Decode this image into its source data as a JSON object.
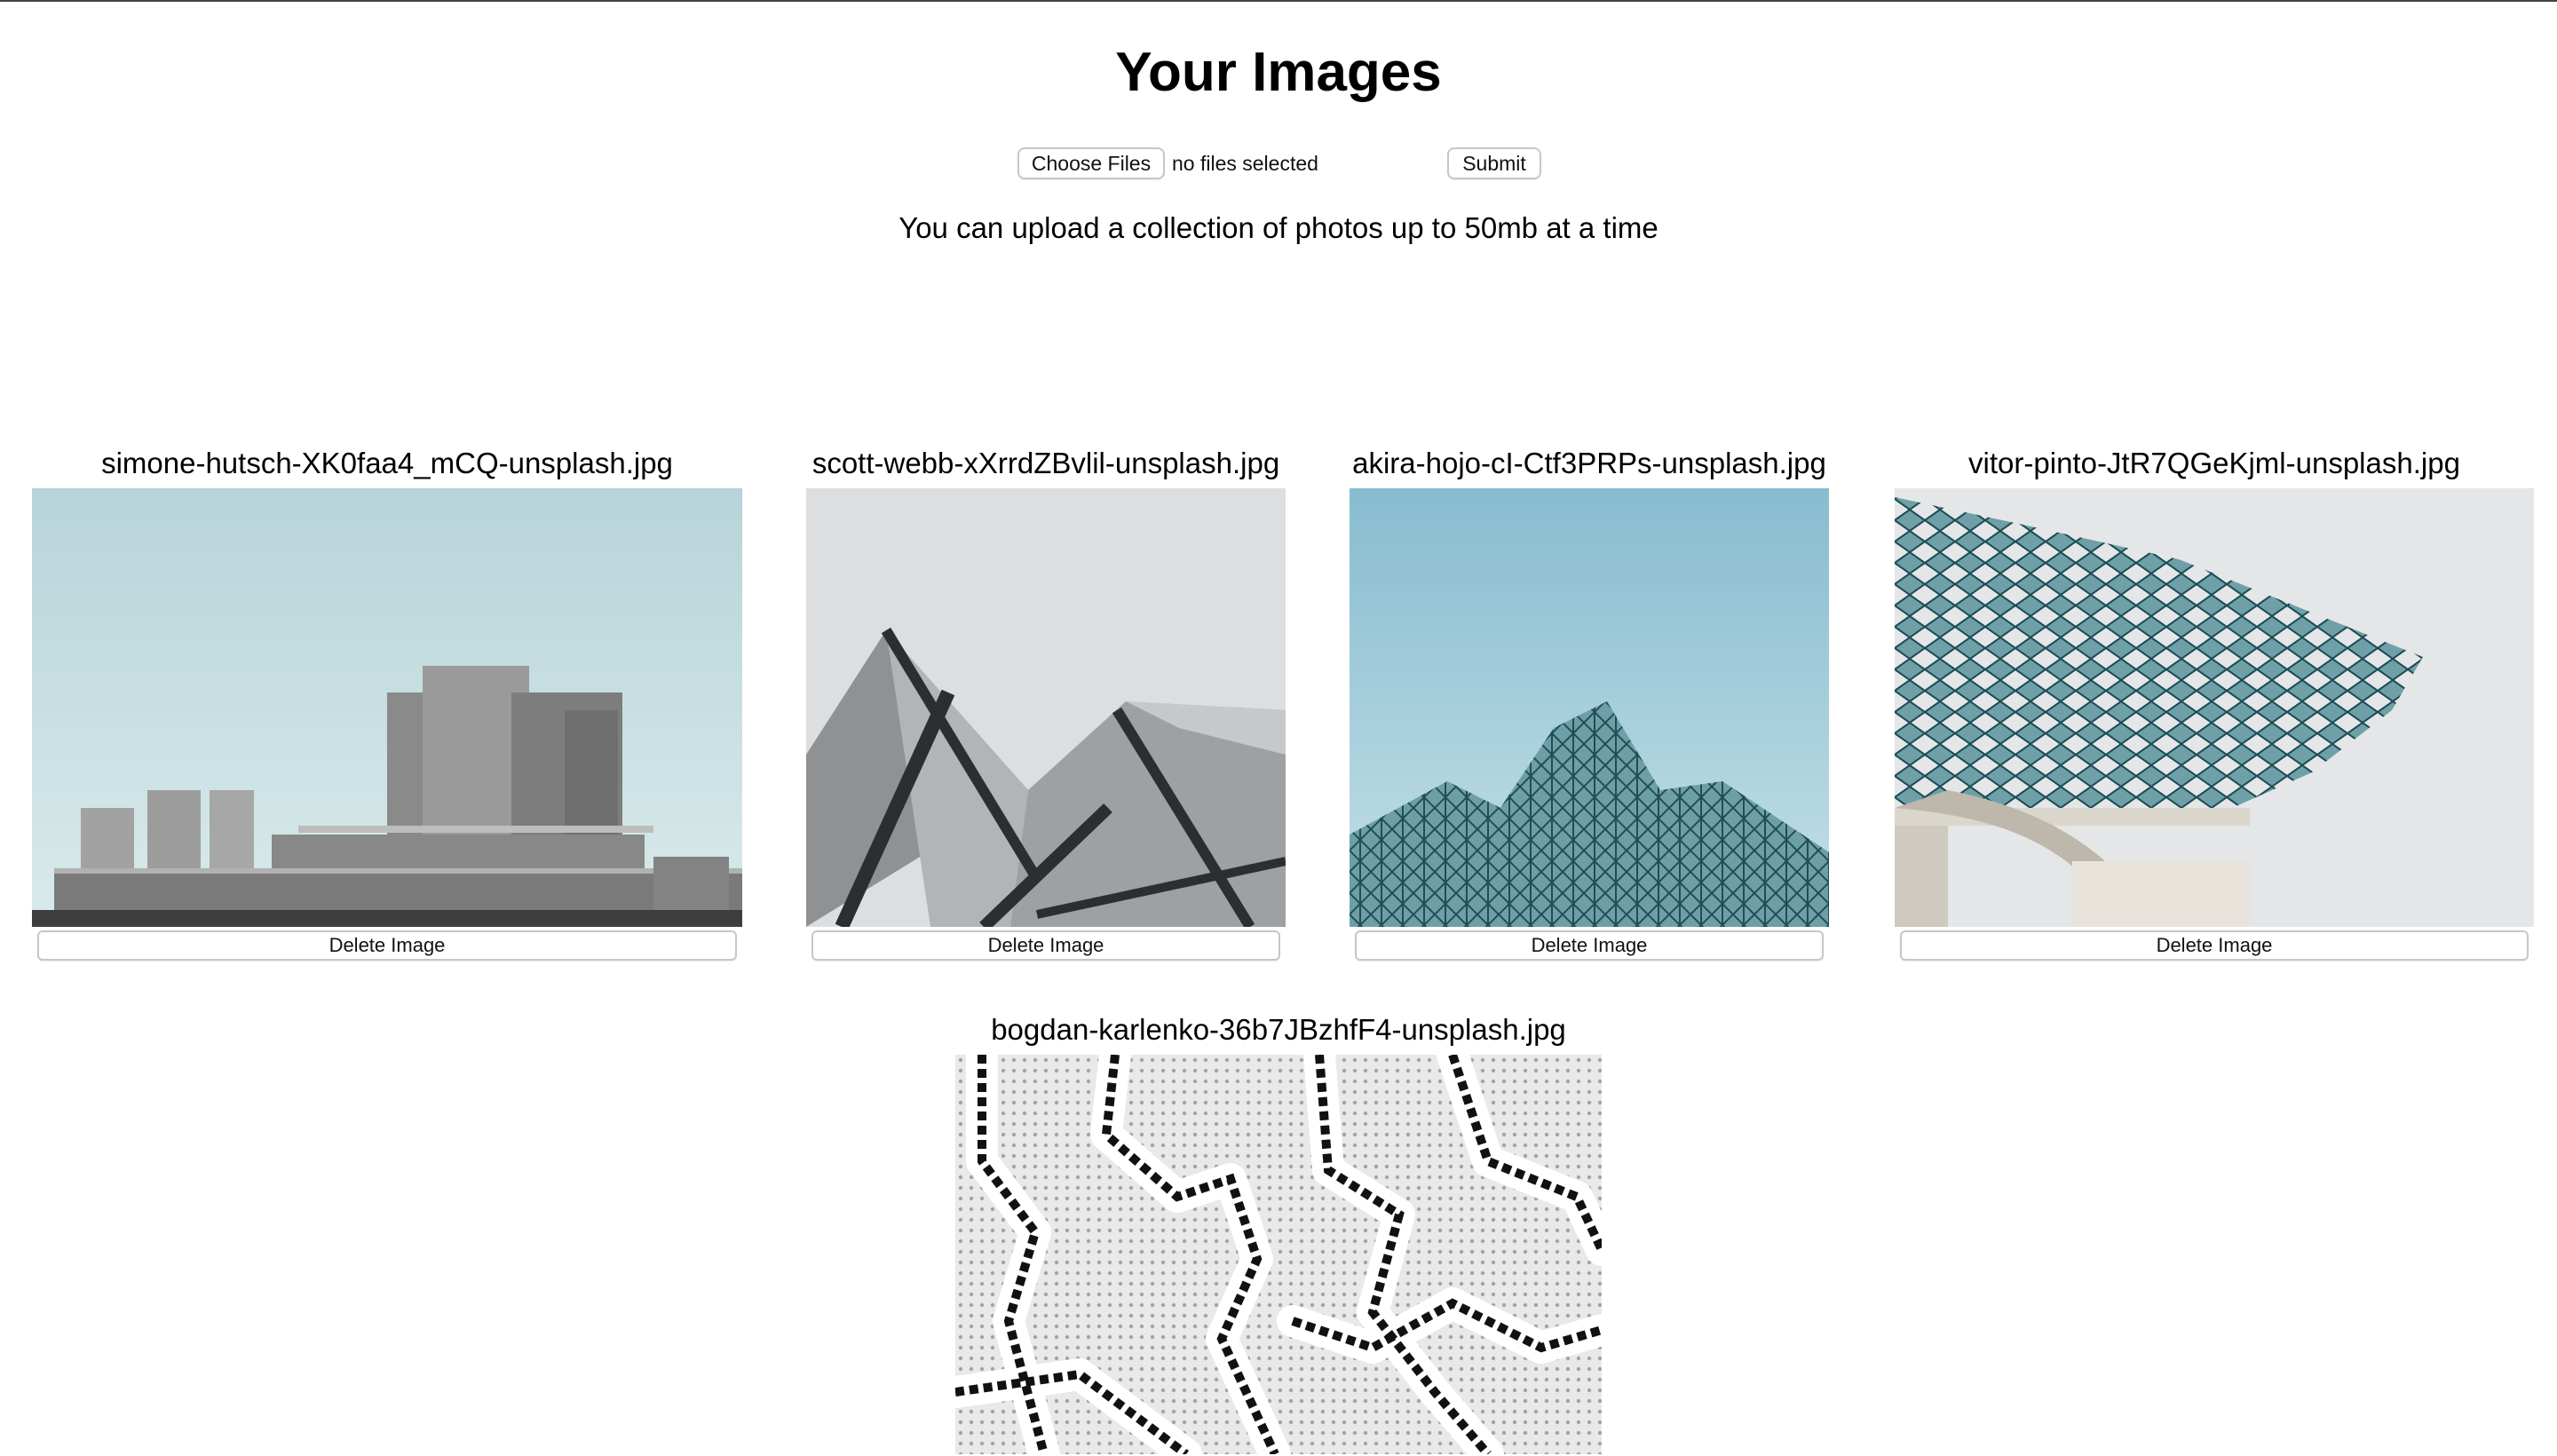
{
  "page": {
    "title": "Your Images",
    "upload_note": "You can upload a collection of photos up to 50mb at a time"
  },
  "upload": {
    "choose_label": "Choose Files",
    "status": "no files selected",
    "submit_label": "Submit"
  },
  "images": [
    {
      "name": "simone-hutsch-XK0faa4_mCQ-unsplash.jpg",
      "delete_label": "Delete Image"
    },
    {
      "name": "scott-webb-xXrrdZBvlil-unsplash.jpg",
      "delete_label": "Delete Image"
    },
    {
      "name": "akira-hojo-cI-Ctf3PRPs-unsplash.jpg",
      "delete_label": "Delete Image"
    },
    {
      "name": "vitor-pinto-JtR7QGeKjml-unsplash.jpg",
      "delete_label": "Delete Image"
    },
    {
      "name": "bogdan-karlenko-36b7JBzhfF4-unsplash.jpg"
    }
  ]
}
